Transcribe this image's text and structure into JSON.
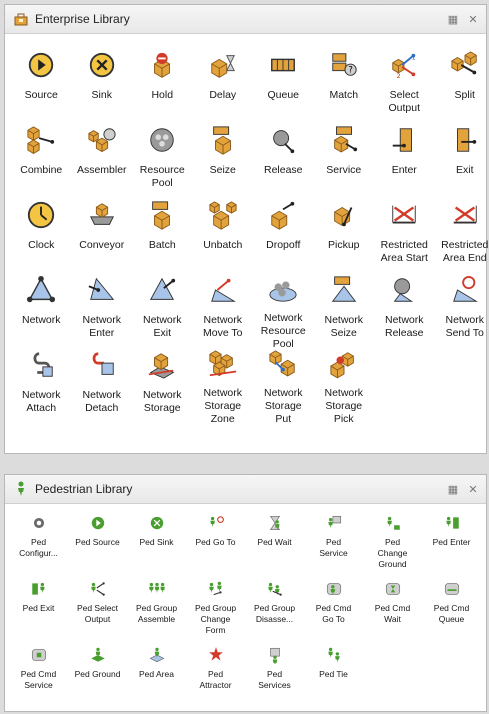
{
  "enterprise": {
    "title": "Enterprise Library",
    "items": [
      {
        "label": "Source",
        "icon": "source-icon"
      },
      {
        "label": "Sink",
        "icon": "sink-icon"
      },
      {
        "label": "Hold",
        "icon": "hold-icon"
      },
      {
        "label": "Delay",
        "icon": "delay-icon"
      },
      {
        "label": "Queue",
        "icon": "queue-icon"
      },
      {
        "label": "Match",
        "icon": "match-icon"
      },
      {
        "label": "Select\nOutput",
        "icon": "select-output-icon"
      },
      {
        "label": "Split",
        "icon": "split-icon"
      },
      {
        "label": "Combine",
        "icon": "combine-icon"
      },
      {
        "label": "Assembler",
        "icon": "assembler-icon"
      },
      {
        "label": "Resource\nPool",
        "icon": "resource-pool-icon"
      },
      {
        "label": "Seize",
        "icon": "seize-icon"
      },
      {
        "label": "Release",
        "icon": "release-icon"
      },
      {
        "label": "Service",
        "icon": "service-icon"
      },
      {
        "label": "Enter",
        "icon": "enter-icon"
      },
      {
        "label": "Exit",
        "icon": "exit-icon"
      },
      {
        "label": "Clock",
        "icon": "clock-icon"
      },
      {
        "label": "Conveyor",
        "icon": "conveyor-icon"
      },
      {
        "label": "Batch",
        "icon": "batch-icon"
      },
      {
        "label": "Unbatch",
        "icon": "unbatch-icon"
      },
      {
        "label": "Dropoff",
        "icon": "dropoff-icon"
      },
      {
        "label": "Pickup",
        "icon": "pickup-icon"
      },
      {
        "label": "Restricted\nArea Start",
        "icon": "restricted-area-start-icon"
      },
      {
        "label": "Restricted\nArea End",
        "icon": "restricted-area-end-icon"
      },
      {
        "label": "Network",
        "icon": "network-icon"
      },
      {
        "label": "Network\nEnter",
        "icon": "network-enter-icon"
      },
      {
        "label": "Network\nExit",
        "icon": "network-exit-icon"
      },
      {
        "label": "Network\nMove To",
        "icon": "network-move-to-icon"
      },
      {
        "label": "Network\nResource\nPool",
        "icon": "network-resource-pool-icon"
      },
      {
        "label": "Network\nSeize",
        "icon": "network-seize-icon"
      },
      {
        "label": "Network\nRelease",
        "icon": "network-release-icon"
      },
      {
        "label": "Network\nSend To",
        "icon": "network-send-to-icon"
      },
      {
        "label": "Network\nAttach",
        "icon": "network-attach-icon"
      },
      {
        "label": "Network\nDetach",
        "icon": "network-detach-icon"
      },
      {
        "label": "Network\nStorage",
        "icon": "network-storage-icon"
      },
      {
        "label": "Network\nStorage\nZone",
        "icon": "network-storage-zone-icon"
      },
      {
        "label": "Network\nStorage\nPut",
        "icon": "network-storage-put-icon"
      },
      {
        "label": "Network\nStorage\nPick",
        "icon": "network-storage-pick-icon"
      }
    ]
  },
  "pedestrian": {
    "title": "Pedestrian Library",
    "items": [
      {
        "label": "Ped\nConfigur...",
        "icon": "ped-configuration-icon"
      },
      {
        "label": "Ped Source",
        "icon": "ped-source-icon"
      },
      {
        "label": "Ped Sink",
        "icon": "ped-sink-icon"
      },
      {
        "label": "Ped Go To",
        "icon": "ped-go-to-icon"
      },
      {
        "label": "Ped Wait",
        "icon": "ped-wait-icon"
      },
      {
        "label": "Ped\nService",
        "icon": "ped-service-icon"
      },
      {
        "label": "Ped\nChange\nGround",
        "icon": "ped-change-ground-icon"
      },
      {
        "label": "Ped Enter",
        "icon": "ped-enter-icon"
      },
      {
        "label": "Ped Exit",
        "icon": "ped-exit-icon"
      },
      {
        "label": "Ped Select\nOutput",
        "icon": "ped-select-output-icon"
      },
      {
        "label": "Ped Group\nAssemble",
        "icon": "ped-group-assemble-icon"
      },
      {
        "label": "Ped Group\nChange\nForm",
        "icon": "ped-group-change-form-icon"
      },
      {
        "label": "Ped Group\nDisasse...",
        "icon": "ped-group-disassemble-icon"
      },
      {
        "label": "Ped Cmd\nGo To",
        "icon": "ped-cmd-go-to-icon"
      },
      {
        "label": "Ped Cmd\nWait",
        "icon": "ped-cmd-wait-icon"
      },
      {
        "label": "Ped Cmd\nQueue",
        "icon": "ped-cmd-queue-icon"
      },
      {
        "label": "Ped Cmd\nService",
        "icon": "ped-cmd-service-icon"
      },
      {
        "label": "Ped Ground",
        "icon": "ped-ground-icon"
      },
      {
        "label": "Ped Area",
        "icon": "ped-area-icon"
      },
      {
        "label": "Ped\nAttractor",
        "icon": "ped-attractor-icon"
      },
      {
        "label": "Ped\nServices",
        "icon": "ped-services-icon"
      },
      {
        "label": "Ped Tie",
        "icon": "ped-tie-icon"
      }
    ]
  },
  "colors": {
    "accent_green": "#4a9e2f",
    "accent_red": "#d23a2a",
    "box_tan": "#e2a33c",
    "blue": "#2f6fc8",
    "gray": "#6b6b6b"
  }
}
